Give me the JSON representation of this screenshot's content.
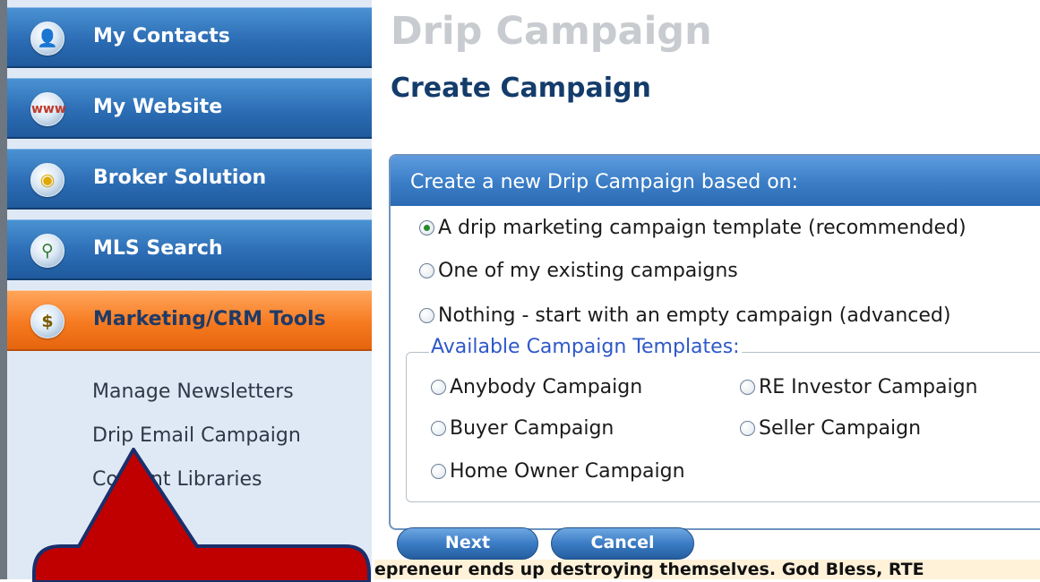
{
  "sidebar": {
    "items": [
      {
        "label": "My Contacts",
        "icon": "contacts-icon"
      },
      {
        "label": "My Website",
        "icon": "website-icon"
      },
      {
        "label": "Broker Solution",
        "icon": "lightbulb-icon"
      },
      {
        "label": "MLS Search",
        "icon": "magnifier-icon"
      },
      {
        "label": "Marketing/CRM Tools",
        "icon": "money-icon",
        "active": true
      }
    ],
    "sub_links": [
      "Manage Newsletters",
      "Drip Email Campaign",
      "Content Libraries"
    ]
  },
  "main": {
    "title": "Drip Campaign",
    "subtitle": "Create Campaign",
    "panel": {
      "header": "Create a new Drip Campaign based on:",
      "options": [
        {
          "label": "A drip marketing campaign template (recommended)",
          "selected": true
        },
        {
          "label": "One of my existing campaigns",
          "selected": false
        },
        {
          "label": "Nothing - start with an empty campaign (advanced)",
          "selected": false
        }
      ],
      "templates_legend": "Available Campaign Templates:",
      "templates": [
        "Anybody Campaign",
        "RE Investor Campaign",
        "Buyer Campaign",
        "Seller Campaign",
        "Home Owner Campaign"
      ]
    },
    "buttons": {
      "next": "Next",
      "cancel": "Cancel"
    },
    "ticker": "epreneur ends up destroying themselves. God Bless, RTE"
  },
  "colors": {
    "nav_blue": "#2c6db5",
    "nav_active_orange": "#f67a20",
    "title_gray": "#c8cbcf",
    "subtitle_navy": "#143c6b",
    "legend_blue": "#2f58c9",
    "callout_red": "#c00000",
    "callout_border": "#1a2f6b"
  }
}
